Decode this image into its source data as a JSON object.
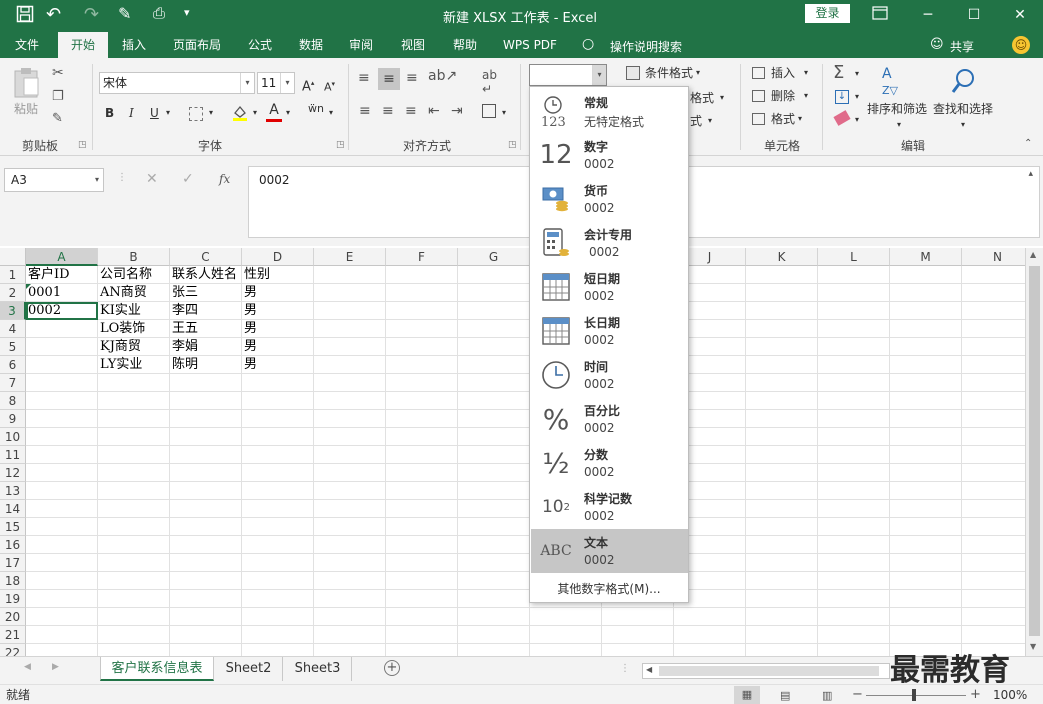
{
  "window": {
    "title": "新建 XLSX 工作表 - Excel",
    "login": "登录",
    "colors": {
      "brand": "#217346",
      "ribbon": "#f3f3f3",
      "selected_item": "#c6c6c6"
    }
  },
  "tabs": [
    "文件",
    "开始",
    "插入",
    "页面布局",
    "公式",
    "数据",
    "审阅",
    "视图",
    "帮助",
    "WPS PDF"
  ],
  "active_tab": "开始",
  "tell_me": "操作说明搜索",
  "share": "共享",
  "ribbon": {
    "clipboard": {
      "paste": "粘贴",
      "label": "剪贴板"
    },
    "font": {
      "name": "宋体",
      "size": "11",
      "bold": "B",
      "italic": "I",
      "underline": "U",
      "label": "字体"
    },
    "alignment": {
      "label": "对齐方式"
    },
    "number": {
      "format_value": ""
    },
    "styles": {
      "conditional": "条件格式",
      "table_format_partial": "格式",
      "cell_style_partial": "式"
    },
    "cells": {
      "insert": "插入",
      "delete": "删除",
      "format": "格式",
      "label": "单元格"
    },
    "editing": {
      "sort_filter": "排序和筛选",
      "find_select": "查找和选择",
      "label": "编辑"
    }
  },
  "formula_bar": {
    "name_box": "A3",
    "content": "0002",
    "fx": "fx"
  },
  "grid": {
    "columns": [
      "A",
      "B",
      "C",
      "D",
      "E",
      "F",
      "G",
      "H",
      "I",
      "J",
      "K",
      "L",
      "M",
      "N"
    ],
    "active_cell": "A3",
    "rows": [
      [
        "客户ID",
        "公司名称",
        "联系人姓名",
        "性别"
      ],
      [
        "0001",
        "AN商贸",
        "张三",
        "男"
      ],
      [
        "0002",
        "KI实业",
        "李四",
        "男"
      ],
      [
        "",
        "LO装饰",
        "王五",
        "男"
      ],
      [
        "",
        "KJ商贸",
        "李娟",
        "男"
      ],
      [
        "",
        "LY实业",
        "陈明",
        "男"
      ]
    ],
    "row_count": 22
  },
  "number_format_menu": {
    "items": [
      {
        "name": "常规",
        "example": "无特定格式",
        "icon": "general-123-icon"
      },
      {
        "name": "数字",
        "example": "0002",
        "icon": "number-12-icon"
      },
      {
        "name": "货币",
        "example": "0002",
        "icon": "currency-icon"
      },
      {
        "name": "会计专用",
        "example": "0002",
        "icon": "accounting-icon"
      },
      {
        "name": "短日期",
        "example": "0002",
        "icon": "short-date-calendar-icon"
      },
      {
        "name": "长日期",
        "example": "0002",
        "icon": "long-date-calendar-icon"
      },
      {
        "name": "时间",
        "example": "0002",
        "icon": "clock-icon"
      },
      {
        "name": "百分比",
        "example": "0002",
        "icon": "percent-icon"
      },
      {
        "name": "分数",
        "example": "0002",
        "icon": "fraction-icon"
      },
      {
        "name": "科学记数",
        "example": "0002",
        "icon": "scientific-icon"
      },
      {
        "name": "文本",
        "example": "0002",
        "icon": "text-abc-icon"
      }
    ],
    "selected": "文本",
    "more": "其他数字格式(M)..."
  },
  "sheets": [
    "客户联系信息表",
    "Sheet2",
    "Sheet3"
  ],
  "active_sheet": "客户联系信息表",
  "status": {
    "ready": "就绪",
    "zoom": "100%",
    "zoom_level": 100
  },
  "watermark": "最需教育"
}
